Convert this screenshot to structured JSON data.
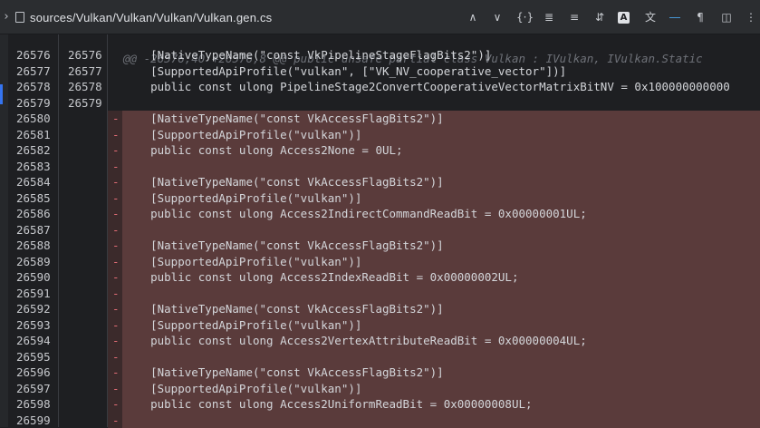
{
  "titlebar": {
    "chevron": "›",
    "file_path": "sources/Vulkan/Vulkan/Vulkan/Vulkan.gen.cs",
    "file_icon": "file-icon",
    "tools": [
      {
        "name": "prev-change-icon",
        "glyph": "∧"
      },
      {
        "name": "next-change-icon",
        "glyph": "∨"
      },
      {
        "name": "whitespace-icon",
        "glyph": "{·}"
      },
      {
        "name": "collapse-icon",
        "glyph": "≣"
      },
      {
        "name": "align-icon",
        "glyph": "≡"
      },
      {
        "name": "sort-lines-icon",
        "glyph": "⇵"
      },
      {
        "name": "highlight-icon",
        "glyph": "A"
      },
      {
        "name": "translate-icon",
        "glyph": "文"
      },
      {
        "name": "wrap-icon",
        "glyph": "―"
      },
      {
        "name": "pilcrow-icon",
        "glyph": "¶"
      },
      {
        "name": "side-by-side-icon",
        "glyph": "◫"
      },
      {
        "name": "more-icon",
        "glyph": "⋮"
      }
    ]
  },
  "diff": {
    "hunk_header": "@@ -26576,40 +26576,8 @@ public unsafe partial class Vulkan : IVulkan, IVulkan.Static",
    "lines": [
      {
        "old": "26576",
        "new": "26576",
        "marker": "",
        "text": "    [NativeTypeName(\"const VkPipelineStageFlagBits2\")]",
        "deleted": false
      },
      {
        "old": "26577",
        "new": "26577",
        "marker": "",
        "text": "    [SupportedApiProfile(\"vulkan\", [\"VK_NV_cooperative_vector\"])]",
        "deleted": false
      },
      {
        "old": "26578",
        "new": "26578",
        "marker": "",
        "text": "    public const ulong PipelineStage2ConvertCooperativeVectorMatrixBitNV = 0x100000000000",
        "deleted": false
      },
      {
        "old": "26579",
        "new": "26579",
        "marker": "",
        "text": "",
        "deleted": false
      },
      {
        "old": "26580",
        "new": "",
        "marker": "-",
        "text": "    [NativeTypeName(\"const VkAccessFlagBits2\")]",
        "deleted": true
      },
      {
        "old": "26581",
        "new": "",
        "marker": "-",
        "text": "    [SupportedApiProfile(\"vulkan\")]",
        "deleted": true
      },
      {
        "old": "26582",
        "new": "",
        "marker": "-",
        "text": "    public const ulong Access2None = 0UL;",
        "deleted": true
      },
      {
        "old": "26583",
        "new": "",
        "marker": "-",
        "text": "",
        "deleted": true
      },
      {
        "old": "26584",
        "new": "",
        "marker": "-",
        "text": "    [NativeTypeName(\"const VkAccessFlagBits2\")]",
        "deleted": true
      },
      {
        "old": "26585",
        "new": "",
        "marker": "-",
        "text": "    [SupportedApiProfile(\"vulkan\")]",
        "deleted": true
      },
      {
        "old": "26586",
        "new": "",
        "marker": "-",
        "text": "    public const ulong Access2IndirectCommandReadBit = 0x00000001UL;",
        "deleted": true
      },
      {
        "old": "26587",
        "new": "",
        "marker": "-",
        "text": "",
        "deleted": true
      },
      {
        "old": "26588",
        "new": "",
        "marker": "-",
        "text": "    [NativeTypeName(\"const VkAccessFlagBits2\")]",
        "deleted": true
      },
      {
        "old": "26589",
        "new": "",
        "marker": "-",
        "text": "    [SupportedApiProfile(\"vulkan\")]",
        "deleted": true
      },
      {
        "old": "26590",
        "new": "",
        "marker": "-",
        "text": "    public const ulong Access2IndexReadBit = 0x00000002UL;",
        "deleted": true
      },
      {
        "old": "26591",
        "new": "",
        "marker": "-",
        "text": "",
        "deleted": true
      },
      {
        "old": "26592",
        "new": "",
        "marker": "-",
        "text": "    [NativeTypeName(\"const VkAccessFlagBits2\")]",
        "deleted": true
      },
      {
        "old": "26593",
        "new": "",
        "marker": "-",
        "text": "    [SupportedApiProfile(\"vulkan\")]",
        "deleted": true
      },
      {
        "old": "26594",
        "new": "",
        "marker": "-",
        "text": "    public const ulong Access2VertexAttributeReadBit = 0x00000004UL;",
        "deleted": true
      },
      {
        "old": "26595",
        "new": "",
        "marker": "-",
        "text": "",
        "deleted": true
      },
      {
        "old": "26596",
        "new": "",
        "marker": "-",
        "text": "    [NativeTypeName(\"const VkAccessFlagBits2\")]",
        "deleted": true
      },
      {
        "old": "26597",
        "new": "",
        "marker": "-",
        "text": "    [SupportedApiProfile(\"vulkan\")]",
        "deleted": true
      },
      {
        "old": "26598",
        "new": "",
        "marker": "-",
        "text": "    public const ulong Access2UniformReadBit = 0x00000008UL;",
        "deleted": true
      },
      {
        "old": "26599",
        "new": "",
        "marker": "-",
        "text": "",
        "deleted": true
      }
    ]
  },
  "colors": {
    "background": "#1e1f22",
    "deleted_line": "#5a3b3b",
    "deleted_marker": "#e06c75",
    "accent": "#3574f0"
  }
}
